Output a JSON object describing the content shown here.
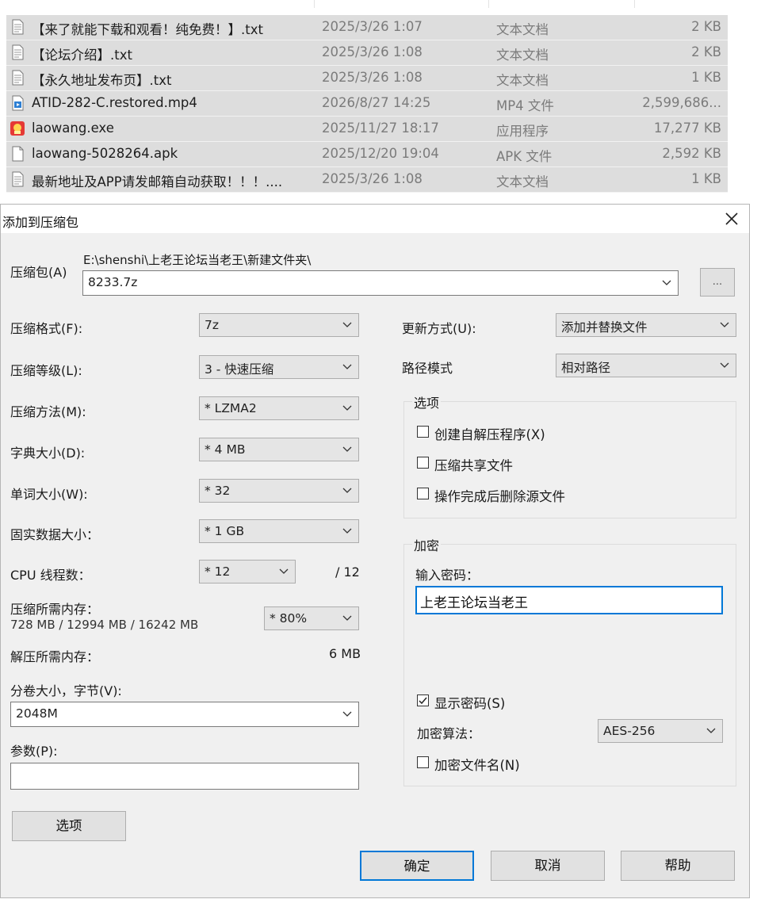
{
  "files": [
    {
      "icon": "text-file-icon",
      "name": "【来了就能下载和观看！纯免费！】.txt",
      "date": "2025/3/26 1:07",
      "type": "文本文档",
      "size": "2 KB"
    },
    {
      "icon": "text-file-icon",
      "name": "【论坛介绍】.txt",
      "date": "2025/3/26 1:08",
      "type": "文本文档",
      "size": "2 KB"
    },
    {
      "icon": "text-file-icon",
      "name": "【永久地址发布页】.txt",
      "date": "2025/3/26 1:08",
      "type": "文本文档",
      "size": "1 KB"
    },
    {
      "icon": "video-file-icon",
      "name": "ATID-282-C.restored.mp4",
      "date": "2026/8/27 14:25",
      "type": "MP4 文件",
      "size": "2,599,686..."
    },
    {
      "icon": "app-exe-icon",
      "name": "laowang.exe",
      "date": "2025/11/27 18:17",
      "type": "应用程序",
      "size": "17,277 KB"
    },
    {
      "icon": "generic-file-icon",
      "name": "laowang-5028264.apk",
      "date": "2025/12/20 19:04",
      "type": "APK 文件",
      "size": "2,592 KB"
    },
    {
      "icon": "text-file-icon",
      "name": "最新地址及APP请发邮箱自动获取！！！....",
      "date": "2025/3/26 1:08",
      "type": "文本文档",
      "size": "1 KB"
    }
  ],
  "dialog": {
    "title": "添加到压缩包",
    "archive_label": "压缩包(A)",
    "archive_path": "E:\\shenshi\\上老王论坛当老王\\新建文件夹\\",
    "archive_name": "8233.7z",
    "browse_label": "...",
    "left": {
      "format": {
        "label": "压缩格式(F):",
        "value": "7z"
      },
      "level": {
        "label": "压缩等级(L):",
        "value": "3 - 快速压缩"
      },
      "method": {
        "label": "压缩方法(M):",
        "value": "* LZMA2"
      },
      "dict": {
        "label": "字典大小(D):",
        "value": "* 4 MB"
      },
      "word": {
        "label": "单词大小(W):",
        "value": "* 32"
      },
      "solid": {
        "label": "固实数据大小：",
        "value": "* 1 GB"
      },
      "threads": {
        "label": "CPU 线程数：",
        "value": "* 12",
        "max": "/ 12"
      },
      "mem_compress": {
        "label": "压缩所需内存：",
        "detail": "728 MB / 12994 MB / 16242 MB",
        "value": "* 80%"
      },
      "mem_decompress": {
        "label": "解压所需内存：",
        "value": "6 MB"
      },
      "volume": {
        "label": "分卷大小，字节(V):",
        "value": "2048M"
      },
      "params": {
        "label": "参数(P):",
        "value": ""
      },
      "options_button": "选项"
    },
    "right": {
      "update": {
        "label": "更新方式(U):",
        "value": "添加并替换文件"
      },
      "path": {
        "label": "路径模式",
        "value": "相对路径"
      },
      "options_group": {
        "title": "选项",
        "sfx": {
          "label": "创建自解压程序(X)",
          "checked": false
        },
        "shared": {
          "label": "压缩共享文件",
          "checked": false
        },
        "delete": {
          "label": "操作完成后删除源文件",
          "checked": false
        }
      },
      "encryption": {
        "title": "加密",
        "password_label": "输入密码：",
        "password": "上老王论坛当老王",
        "show_password": {
          "label": "显示密码(S)",
          "checked": true
        },
        "method_label": "加密算法：",
        "method_value": "AES-256",
        "encrypt_names": {
          "label": "加密文件名(N)",
          "checked": false
        }
      }
    },
    "buttons": {
      "ok": "确定",
      "cancel": "取消",
      "help": "帮助"
    }
  }
}
